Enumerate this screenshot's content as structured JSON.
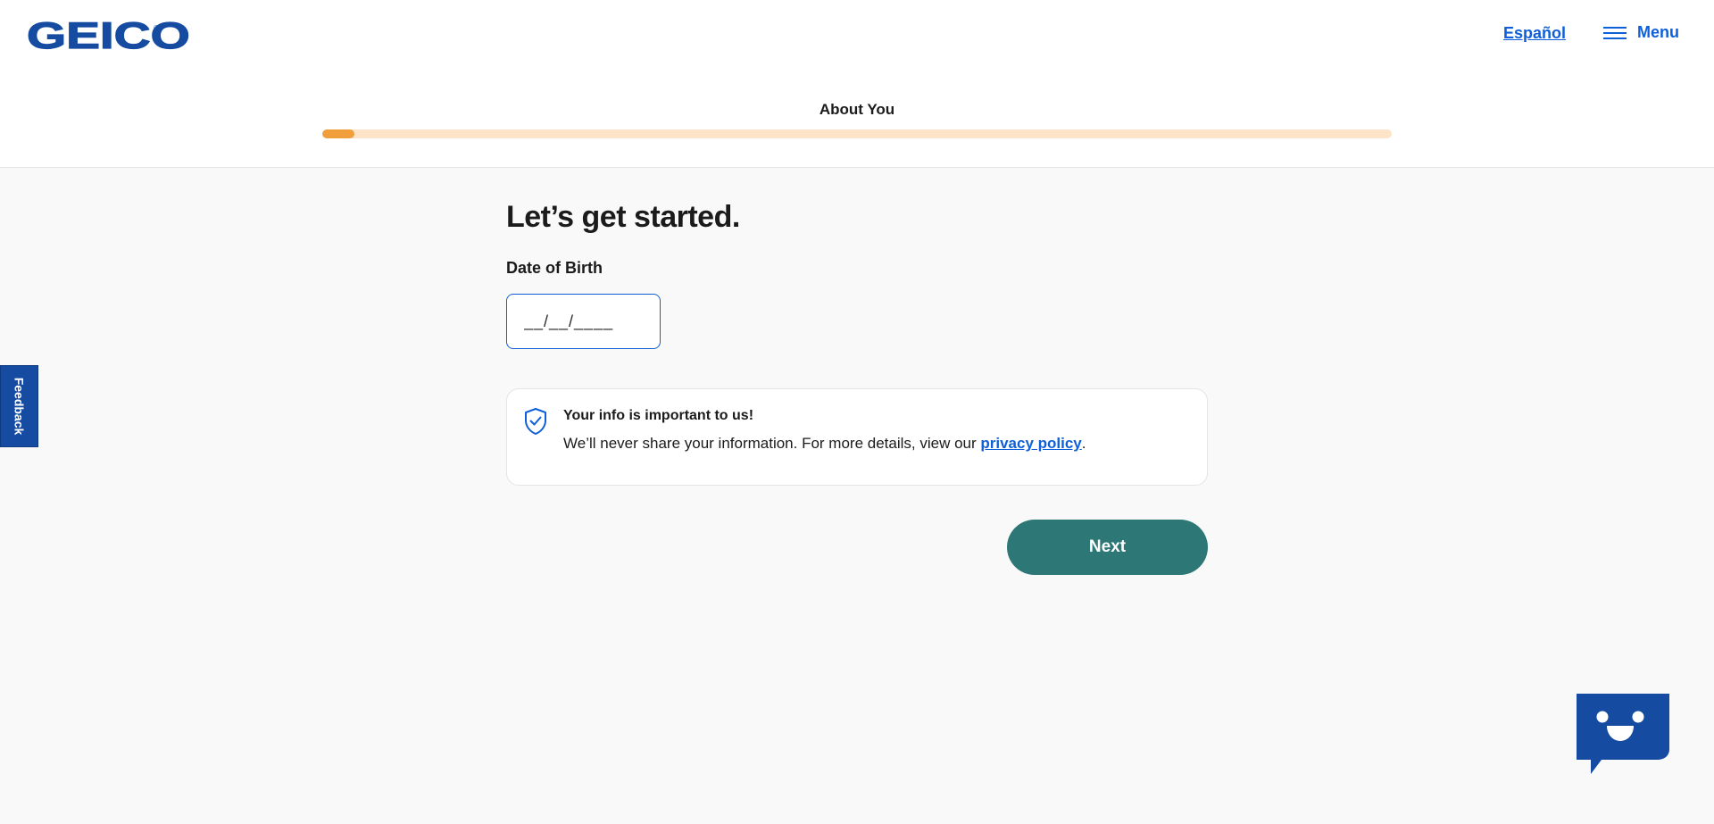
{
  "header": {
    "logo_text": "GEICO",
    "logo_mark": "®",
    "language_link": "Español",
    "menu_label": "Menu",
    "menu_icon": "hamburger-icon"
  },
  "progress": {
    "step_title": "About You",
    "percent": 3
  },
  "form": {
    "heading": "Let’s get started.",
    "dob_label": "Date of Birth",
    "dob_placeholder": "__/__/____",
    "dob_value": ""
  },
  "info_card": {
    "icon": "shield-check-icon",
    "title": "Your info is important to us!",
    "body_prefix": "We’ll never share your information. For more details, view our ",
    "link_text": "privacy policy",
    "body_suffix": "."
  },
  "actions": {
    "next_label": "Next"
  },
  "feedback": {
    "label": "Feedback"
  },
  "chat": {
    "icon": "chat-bot-icon"
  },
  "colors": {
    "brand_blue": "#154ba1",
    "link_blue": "#0e5fd8",
    "progress_fill": "#f19e3d",
    "progress_track": "#fde4c8",
    "next_button": "#2d7776",
    "page_bg": "#f9f9f9"
  }
}
